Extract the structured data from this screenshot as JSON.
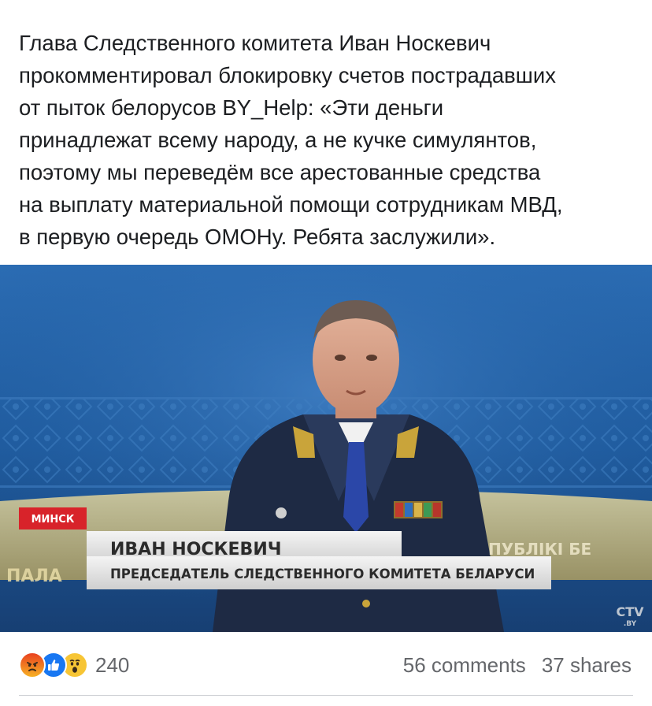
{
  "post": {
    "text": "Глава Следственного комитета Иван Носкевич\nпрокомментировал блокировку счетов пострадавших\nот пыток белорусов BY_Help: «Эти деньги\nпринадлежат всему народу, а не кучке симулянтов,\nпоэтому мы переведём все арестованные средства\nна выплату материальной помощи сотрудникам МВД,\nв первую очередь ОМОНу. Ребята заслужили»."
  },
  "media": {
    "location_tag": "МИНСК",
    "person_name": "ИВАН НОСКЕВИЧ",
    "person_title": "ПРЕДСЕДАТЕЛЬ СЛЕДСТВЕННОГО КОМИТЕТА БЕЛАРУСИ",
    "left_fragment": "ПАЛА",
    "right_fragment": "ПУБЛІКІ БЕ",
    "channel_logo_top": "CTV",
    "channel_logo_bottom": ".BY"
  },
  "footer": {
    "reactions": [
      "angry-icon",
      "like-icon",
      "wow-icon"
    ],
    "reaction_count": "240",
    "comments": "56 comments",
    "shares": "37 shares"
  },
  "colors": {
    "tag_red": "#d8232a",
    "meta_gray": "#65676b",
    "like_blue": "#1877f2"
  }
}
